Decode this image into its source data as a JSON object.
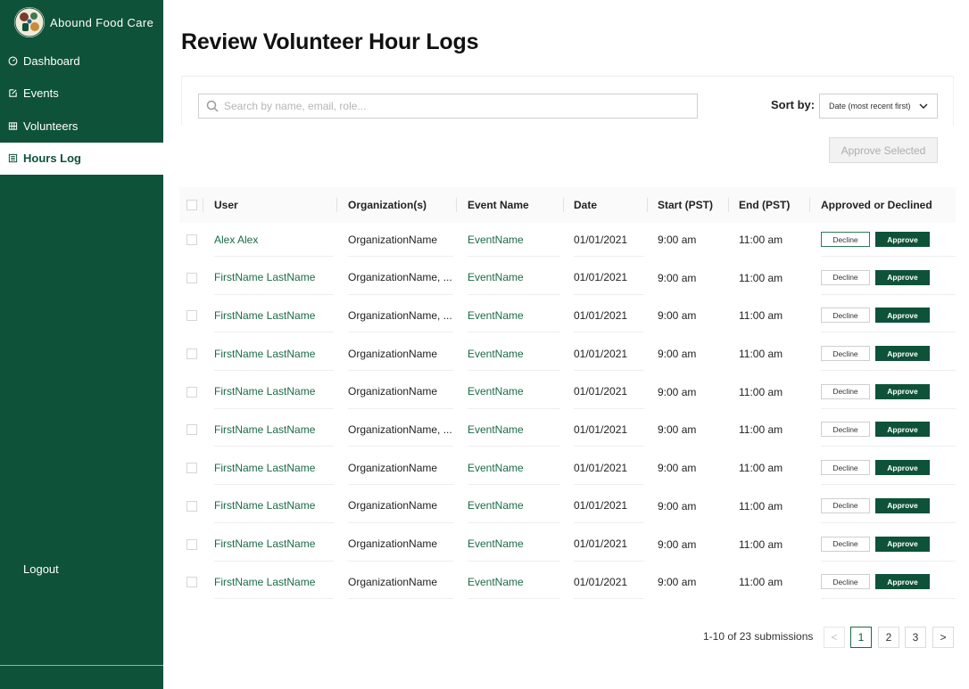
{
  "brand": {
    "name": "Abound Food Care"
  },
  "nav": {
    "items": [
      {
        "label": "Dashboard",
        "icon": "dashboard-icon"
      },
      {
        "label": "Events",
        "icon": "edit-icon"
      },
      {
        "label": "Volunteers",
        "icon": "grid-icon"
      },
      {
        "label": "Hours Log",
        "icon": "list-icon",
        "active": true
      }
    ],
    "logout": "Logout"
  },
  "page": {
    "title": "Review Volunteer Hour Logs"
  },
  "toolbar": {
    "search_placeholder": "Search by name, email, role...",
    "sort_label": "Sort by:",
    "sort_value": "Date (most recent first)",
    "approve_selected": "Approve Selected"
  },
  "table": {
    "headers": {
      "user": "User",
      "org": "Organization(s)",
      "event": "Event Name",
      "date": "Date",
      "start": "Start (PST)",
      "end": "End (PST)",
      "status": "Approved or Declined"
    },
    "decline_label": "Decline",
    "approve_label": "Approve",
    "rows": [
      {
        "user": "Alex Alex",
        "org": "OrganizationName",
        "event": "EventName",
        "date": "01/01/2021",
        "start": "9:00 am",
        "end": "11:00 am"
      },
      {
        "user": "FirstName LastName",
        "org": "OrganizationName, ...",
        "event": "EventName",
        "date": "01/01/2021",
        "start": "9:00 am",
        "end": "11:00 am"
      },
      {
        "user": "FirstName LastName",
        "org": "OrganizationName, ...",
        "event": "EventName",
        "date": "01/01/2021",
        "start": "9:00 am",
        "end": "11:00 am"
      },
      {
        "user": "FirstName LastName",
        "org": "OrganizationName",
        "event": "EventName",
        "date": "01/01/2021",
        "start": "9:00 am",
        "end": "11:00 am"
      },
      {
        "user": "FirstName LastName",
        "org": "OrganizationName",
        "event": "EventName",
        "date": "01/01/2021",
        "start": "9:00 am",
        "end": "11:00 am"
      },
      {
        "user": "FirstName LastName",
        "org": "OrganizationName, ...",
        "event": "EventName",
        "date": "01/01/2021",
        "start": "9:00 am",
        "end": "11:00 am"
      },
      {
        "user": "FirstName LastName",
        "org": "OrganizationName",
        "event": "EventName",
        "date": "01/01/2021",
        "start": "9:00 am",
        "end": "11:00 am"
      },
      {
        "user": "FirstName LastName",
        "org": "OrganizationName",
        "event": "EventName",
        "date": "01/01/2021",
        "start": "9:00 am",
        "end": "11:00 am"
      },
      {
        "user": "FirstName LastName",
        "org": "OrganizationName",
        "event": "EventName",
        "date": "01/01/2021",
        "start": "9:00 am",
        "end": "11:00 am"
      },
      {
        "user": "FirstName LastName",
        "org": "OrganizationName",
        "event": "EventName",
        "date": "01/01/2021",
        "start": "9:00 am",
        "end": "11:00 am"
      }
    ]
  },
  "pagination": {
    "summary": "1-10 of 23 submissions",
    "prev": "<",
    "next": ">",
    "pages": [
      "1",
      "2",
      "3"
    ],
    "current_page": "1"
  },
  "colors": {
    "brand_green": "#0e5239",
    "link_green": "#1b6b47"
  }
}
